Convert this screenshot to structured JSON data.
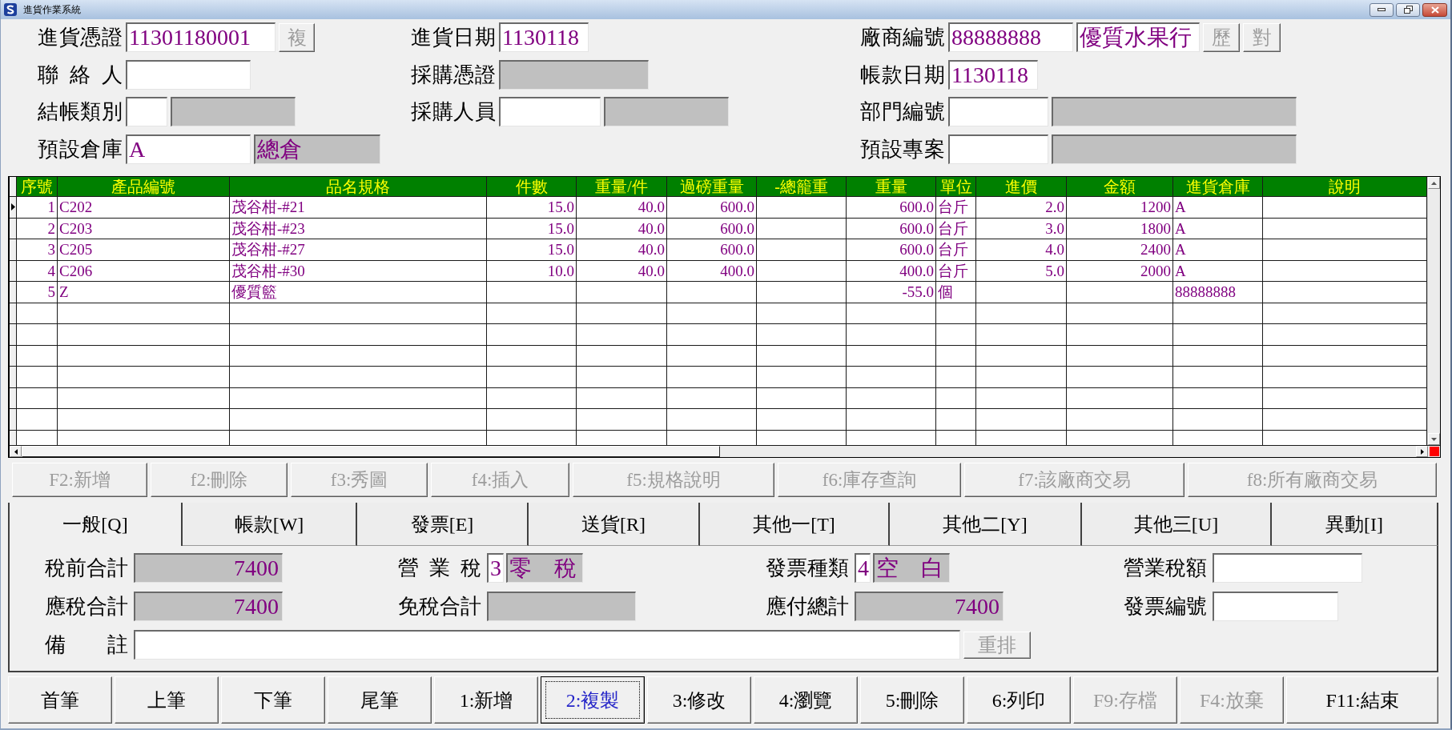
{
  "window": {
    "title": "進貨作業系統"
  },
  "header": {
    "columns": [
      [
        {
          "label": "進貨憑證",
          "inputs": [
            {
              "value": "11301180001",
              "readonly": false
            }
          ],
          "buttons": [
            {
              "label": "複",
              "disabled": true
            }
          ]
        },
        {
          "label": "聯 絡 人",
          "inputs": [
            {
              "readonly": false
            }
          ]
        },
        {
          "label": "結帳類別",
          "inputs": [
            {
              "readonly": false
            },
            {
              "readonly": true
            }
          ]
        },
        {
          "label": "預設倉庫",
          "inputs": [
            {
              "value": "A",
              "readonly": false
            },
            {
              "value": "總倉",
              "readonly": true
            }
          ]
        }
      ],
      [
        {
          "label": "進貨日期",
          "inputs": [
            {
              "value": "1130118",
              "readonly": false
            }
          ]
        },
        {
          "label": "採購憑證",
          "inputs": [
            {
              "readonly": true
            }
          ]
        },
        {
          "label": "採購人員",
          "inputs": [
            {
              "readonly": false
            },
            {
              "readonly": true
            }
          ]
        }
      ],
      [
        {
          "label": "廠商編號",
          "inputs": [
            {
              "value": "88888888",
              "readonly": false
            },
            {
              "value": "優質水果行",
              "readonly": false
            }
          ],
          "buttons": [
            {
              "label": "歷",
              "disabled": true
            },
            {
              "label": "對",
              "disabled": true
            }
          ]
        },
        {
          "label": "帳款日期",
          "inputs": [
            {
              "value": "1130118",
              "readonly": false
            }
          ]
        },
        {
          "label": "部門編號",
          "inputs": [
            {
              "readonly": false
            },
            {
              "readonly": true
            }
          ]
        },
        {
          "label": "預設專案",
          "inputs": [
            {
              "readonly": false
            },
            {
              "readonly": true
            }
          ]
        }
      ]
    ]
  },
  "table": {
    "columns": [
      {
        "label": "序號",
        "kind": "number"
      },
      {
        "label": "產品編號",
        "kind": "text"
      },
      {
        "label": "品名規格",
        "kind": "text"
      },
      {
        "label": "件數",
        "kind": "number"
      },
      {
        "label": "重量/件",
        "kind": "number"
      },
      {
        "label": "過磅重量",
        "kind": "number"
      },
      {
        "label": "-總籠重"
      },
      {
        "label": "重量",
        "kind": "number"
      },
      {
        "label": "單位",
        "kind": "text"
      },
      {
        "label": "進價",
        "kind": "number"
      },
      {
        "label": "金額",
        "kind": "number"
      },
      {
        "label": "進貨倉庫",
        "kind": "text"
      },
      {
        "label": "說明"
      }
    ],
    "rows": [
      {
        "current": true,
        "cells": [
          "1",
          "C202",
          "茂谷柑-#21",
          "15.0",
          "40.0",
          "600.0",
          null,
          "600.0",
          "台斤",
          "2.0",
          "1200",
          "A",
          null
        ]
      },
      {
        "current": false,
        "cells": [
          "2",
          "C203",
          "茂谷柑-#23",
          "15.0",
          "40.0",
          "600.0",
          null,
          "600.0",
          "台斤",
          "3.0",
          "1800",
          "A",
          null
        ]
      },
      {
        "current": false,
        "cells": [
          "3",
          "C205",
          "茂谷柑-#27",
          "15.0",
          "40.0",
          "600.0",
          null,
          "600.0",
          "台斤",
          "4.0",
          "2400",
          "A",
          null
        ]
      },
      {
        "current": false,
        "cells": [
          "4",
          "C206",
          "茂谷柑-#30",
          "10.0",
          "40.0",
          "400.0",
          null,
          "400.0",
          "台斤",
          "5.0",
          "2000",
          "A",
          null
        ]
      },
      {
        "current": false,
        "cells": [
          "5",
          "Z",
          "優質籃",
          null,
          null,
          null,
          null,
          "-55.0",
          "個",
          null,
          null,
          "88888888",
          null
        ]
      }
    ]
  },
  "function_buttons": [
    {
      "label": "F2:新增",
      "disabled": true
    },
    {
      "label": "f2:刪除",
      "disabled": true
    },
    {
      "label": "f3:秀圖",
      "disabled": true
    },
    {
      "label": "f4:插入",
      "disabled": true
    },
    {
      "label": "f5:規格說明",
      "disabled": true
    },
    {
      "label": "f6:庫存查詢",
      "disabled": true
    },
    {
      "label": "f7:該廠商交易",
      "disabled": true
    },
    {
      "label": "f8:所有廠商交易",
      "disabled": true
    }
  ],
  "tabs": [
    {
      "label": "一般[Q]",
      "selected": true
    },
    {
      "label": "帳款[W]",
      "selected": false
    },
    {
      "label": "發票[E]",
      "selected": false
    },
    {
      "label": "送貨[R]",
      "selected": false
    },
    {
      "label": "其他一[T]",
      "selected": false
    },
    {
      "label": "其他二[Y]",
      "selected": false
    },
    {
      "label": "其他三[U]",
      "selected": false
    },
    {
      "label": "異動[I]",
      "selected": false
    }
  ],
  "tab_panel": {
    "rows": [
      [
        {
          "label": "稅前合計",
          "inputs": [
            {
              "value": "7400",
              "kind": "amount",
              "readonly": true
            }
          ]
        },
        {
          "label": "營 業 稅",
          "inputs": [
            {
              "value": "3",
              "kind": "text",
              "readonly": false
            },
            {
              "value": "零　稅",
              "kind": "text",
              "readonly": true
            }
          ]
        },
        {
          "label": "發票種類",
          "inputs": [
            {
              "value": "4",
              "kind": "text",
              "readonly": false
            },
            {
              "value": "空　白",
              "kind": "text",
              "readonly": true
            }
          ]
        },
        {
          "label": "營業稅額",
          "inputs": [
            {
              "readonly": false
            }
          ]
        }
      ],
      [
        {
          "label": "應稅合計",
          "inputs": [
            {
              "value": "7400",
              "kind": "amount",
              "readonly": true
            }
          ]
        },
        {
          "label": "免稅合計",
          "inputs": [
            {
              "readonly": true
            }
          ]
        },
        {
          "label": "應付總計",
          "inputs": [
            {
              "value": "7400",
              "kind": "amount",
              "readonly": true
            }
          ]
        },
        {
          "label": "發票編號",
          "inputs": [
            {
              "readonly": false
            }
          ]
        }
      ],
      [
        {
          "label": "備 註",
          "inputs": [
            {
              "readonly": false
            }
          ],
          "buttons": [
            {
              "label": "重排",
              "disabled": true
            }
          ]
        }
      ]
    ]
  },
  "command_buttons": [
    {
      "label": "首筆",
      "disabled": false,
      "focused": false
    },
    {
      "label": "上筆",
      "disabled": false,
      "focused": false
    },
    {
      "label": "下筆",
      "disabled": false,
      "focused": false
    },
    {
      "label": "尾筆",
      "disabled": false,
      "focused": false
    },
    {
      "label": "1:新增",
      "disabled": false,
      "focused": false
    },
    {
      "label": "2:複製",
      "disabled": false,
      "focused": true
    },
    {
      "label": "3:修改",
      "disabled": false,
      "focused": false
    },
    {
      "label": "4:瀏覽",
      "disabled": false,
      "focused": false
    },
    {
      "label": "5:刪除",
      "disabled": false,
      "focused": false
    },
    {
      "label": "6:列印",
      "disabled": false,
      "focused": false
    },
    {
      "label": "F9:存檔",
      "disabled": true,
      "focused": false
    },
    {
      "label": "F4:放棄",
      "disabled": true,
      "focused": false
    },
    {
      "label": "F11:結束",
      "disabled": false,
      "focused": false
    }
  ]
}
